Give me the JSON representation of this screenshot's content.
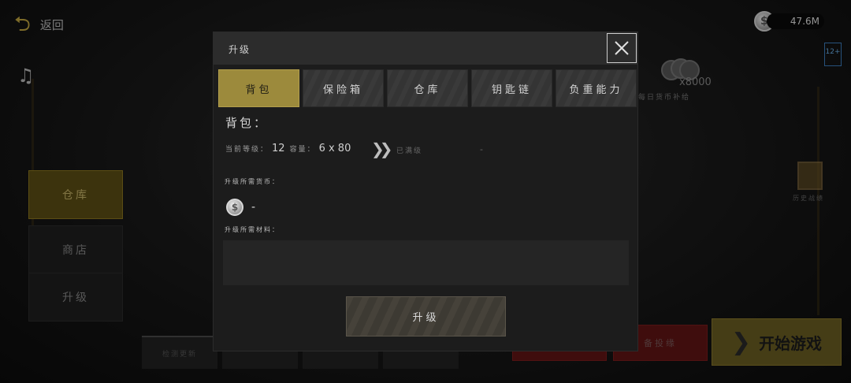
{
  "background": {
    "back_label": "返回",
    "currency_value": "47.6M",
    "age_rating": "12+",
    "side_menu": [
      {
        "label": "仓库",
        "active": true
      },
      {
        "label": "商店",
        "active": false
      },
      {
        "label": "升级",
        "active": false
      }
    ],
    "coins_amount": "x8000",
    "daily_label": "每日货币补给",
    "history_label": "历史战绩",
    "red_button_label": "备投缘",
    "start_game_label": "开始游戏",
    "bottom_tabs": [
      "检测更新",
      "",
      "",
      ""
    ]
  },
  "modal": {
    "title": "升级",
    "tabs": [
      {
        "label": "背包",
        "active": true
      },
      {
        "label": "保险箱",
        "active": false
      },
      {
        "label": "仓库",
        "active": false
      },
      {
        "label": "钥匙链",
        "active": false
      },
      {
        "label": "负重能力",
        "active": false
      }
    ],
    "section_title": "背包：",
    "level_label": "当前等级：",
    "level_value": "12",
    "capacity_label": "容量：",
    "capacity_value": "6 x 80",
    "maxed_label": "已满级",
    "next_value": "-",
    "currency_required_label": "升级所需货币：",
    "currency_required_value": "-",
    "material_required_label": "升级所需材料：",
    "upgrade_button_label": "升级"
  },
  "colors": {
    "accent_gold": "#9c8a3c",
    "active_side": "#5d4f14",
    "start_button": "#6b5e22",
    "red_button": "#621414"
  }
}
